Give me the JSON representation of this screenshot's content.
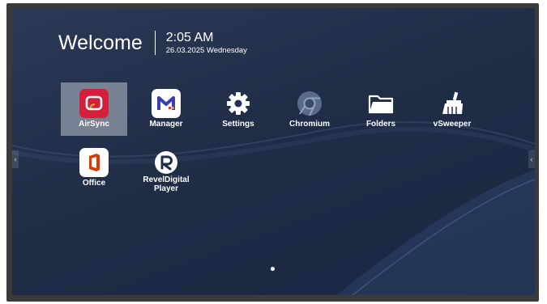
{
  "header": {
    "welcome": "Welcome",
    "time": "2:05 AM",
    "date": "26.03.2025 Wednesday"
  },
  "apps": [
    {
      "label": "AirSync",
      "icon": "airsync-icon",
      "selected": true
    },
    {
      "label": "Manager",
      "icon": "manager-icon"
    },
    {
      "label": "Settings",
      "icon": "gear-icon"
    },
    {
      "label": "Chromium",
      "icon": "chromium-icon"
    },
    {
      "label": "Folders",
      "icon": "folder-icon"
    },
    {
      "label": "vSweeper",
      "icon": "broom-icon"
    },
    {
      "label": "Office",
      "icon": "office-icon"
    },
    {
      "label_line1": "RevelDigital",
      "label_line2": "Player",
      "icon": "reveldigital-icon"
    }
  ],
  "pager": {
    "pages": 1,
    "current": 1
  },
  "edge_arrows": {
    "left": "‹",
    "right": "‹"
  },
  "colors": {
    "background": "#1f2d47",
    "selected_tile": "#bec3cd",
    "airsync": "#d3203a",
    "manager": "#3a3fb8",
    "office": "#d83b01"
  }
}
